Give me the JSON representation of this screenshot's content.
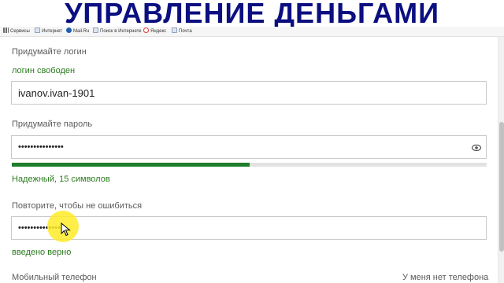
{
  "banner": {
    "title": "УПРАВЛЕНИЕ ДЕНЬГАМИ"
  },
  "bookmarks": [
    {
      "label": "Сервисы",
      "icon": "apps-grid-icon",
      "color": "#6a6a6a"
    },
    {
      "label": "Интернет",
      "icon": "page-icon",
      "color": "#8aa0c0"
    },
    {
      "label": "Mail.Ru",
      "icon": "mailru-icon",
      "color": "#1d5fb5"
    },
    {
      "label": "Поиск в Интернете",
      "icon": "page-icon",
      "color": "#8aa0c0"
    },
    {
      "label": "Яндекс",
      "icon": "yandex-icon",
      "color": "#d33"
    },
    {
      "label": "Почта",
      "icon": "page-icon",
      "color": "#8aa0c0"
    }
  ],
  "form": {
    "login": {
      "label": "Придумайте логин",
      "status": "логин свободен",
      "value": "ivanov.ivan-1901"
    },
    "password": {
      "label": "Придумайте пароль",
      "value": "•••••••••••••••",
      "strength_fraction": 0.5,
      "strength_text": "Надежный, 15 символов",
      "strength_color": "#1f7d2b",
      "toggle_icon": "eye-icon"
    },
    "confirm": {
      "label": "Повторите, чтобы не ошибиться",
      "value": "•••••••••••••••",
      "status": "введено верно"
    },
    "phone": {
      "label": "Мобильный телефон",
      "no_phone_link": "У меня нет телефона"
    }
  },
  "colors": {
    "banner_text": "#0b0f80",
    "success_text": "#2a7a1c",
    "cursor_highlight": "#ffeb28"
  }
}
